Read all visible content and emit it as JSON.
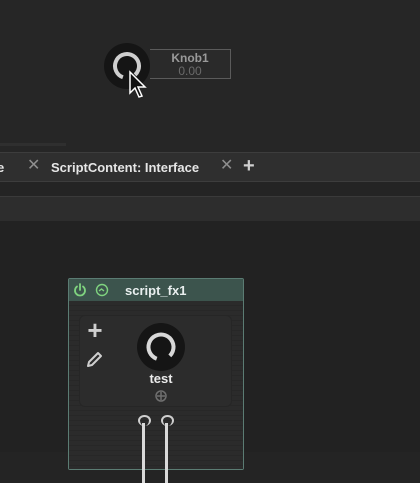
{
  "knob1": {
    "name": "Knob1",
    "value": "0.00"
  },
  "tabs": [
    {
      "label": "e"
    },
    {
      "label": "ScriptContent: Interface"
    }
  ],
  "tab_add_symbol": "+",
  "module": {
    "title": "script_fx1",
    "knob_label": "test"
  },
  "icons": {
    "power": "power-icon",
    "bypass": "bypass-icon",
    "add": "plus-icon",
    "edit": "pencil-icon",
    "modulation": "crosshair-icon",
    "close": "close-icon",
    "cursor": "mouse-cursor-icon"
  },
  "colors": {
    "background": "#242424",
    "module_header": "#3c544d",
    "module_border": "#5b7c73",
    "power_green": "#7fd37f"
  }
}
